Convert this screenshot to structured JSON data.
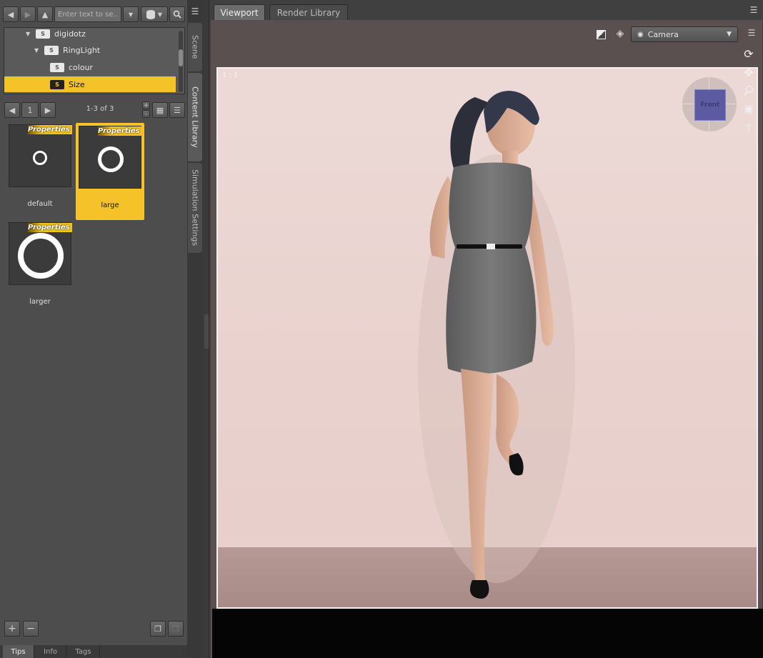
{
  "library": {
    "search_placeholder": "Enter text to se...",
    "tree": [
      {
        "label": "digidotz",
        "expanded": true,
        "depth": 0
      },
      {
        "label": "RingLight",
        "expanded": true,
        "depth": 1
      },
      {
        "label": "colour",
        "expanded": false,
        "depth": 2
      },
      {
        "label": "Size",
        "expanded": false,
        "depth": 2,
        "selected": true
      }
    ],
    "page": "1",
    "page_count": "1-3 of 3",
    "items": [
      {
        "label": "default",
        "badge": "Properties",
        "ring": "small"
      },
      {
        "label": "large",
        "badge": "Properties",
        "ring": "medium",
        "selected": true
      },
      {
        "label": "larger",
        "badge": "Properties",
        "ring": "big"
      }
    ],
    "bottom_tabs": [
      "Tips",
      "Info",
      "Tags"
    ]
  },
  "side_tabs": [
    "Scene",
    "Content Library",
    "Simulation Settings"
  ],
  "viewport": {
    "tabs": [
      "Viewport",
      "Render Library"
    ],
    "camera": "Camera",
    "ratio": "1 : 1",
    "cube_label": "Front"
  },
  "colors": {
    "accent": "#f6c22a",
    "panel": "#4d4d4d",
    "dark": "#3a3a3a"
  }
}
